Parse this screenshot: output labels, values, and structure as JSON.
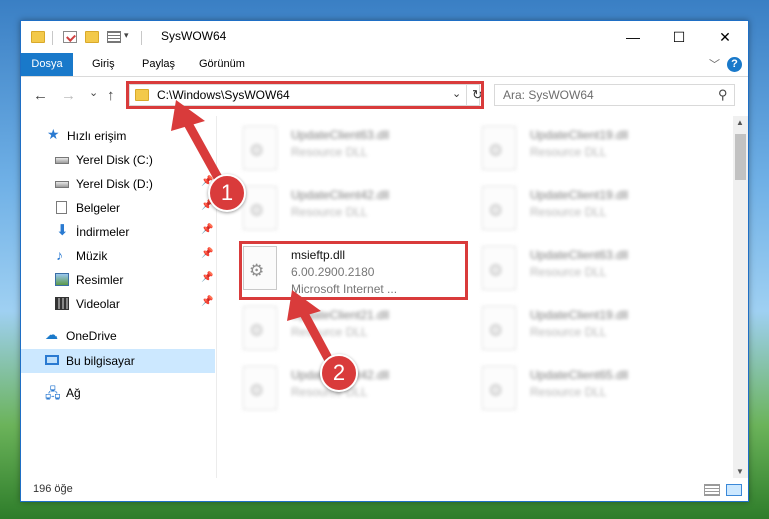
{
  "window": {
    "title": "SysWOW64",
    "minimize_glyph": "—",
    "maximize_glyph": "☐",
    "close_glyph": "✕",
    "accent": "#1979ca"
  },
  "ribbon": {
    "tabs": [
      "Dosya",
      "Giriş",
      "Paylaş",
      "Görünüm"
    ],
    "help_glyph": "?",
    "collapse_glyph": "﹀"
  },
  "nav": {
    "back_glyph": "←",
    "forward_glyph": "→",
    "recent_glyph": "⌄",
    "up_glyph": "↑",
    "address": "C:\\Windows\\SysWOW64",
    "address_chevron": "⌄",
    "refresh_glyph": "↻",
    "search_placeholder": "Ara: SysWOW64",
    "search_glyph": "⚲"
  },
  "sidebar": {
    "items": [
      {
        "label": "Hızlı erişim",
        "icon": "star-icon",
        "pinned": false
      },
      {
        "label": "Yerel Disk (C:)",
        "icon": "drive-icon",
        "pinned": true
      },
      {
        "label": "Yerel Disk (D:)",
        "icon": "drive-icon",
        "pinned": true
      },
      {
        "label": "Belgeler",
        "icon": "documents-icon",
        "pinned": true
      },
      {
        "label": "İndirmeler",
        "icon": "downloads-icon",
        "pinned": true
      },
      {
        "label": "Müzik",
        "icon": "music-icon",
        "pinned": true
      },
      {
        "label": "Resimler",
        "icon": "pictures-icon",
        "pinned": true
      },
      {
        "label": "Videolar",
        "icon": "videos-icon",
        "pinned": true
      },
      {
        "label": "OneDrive",
        "icon": "onedrive-icon",
        "pinned": false
      },
      {
        "label": "Bu bilgisayar",
        "icon": "this-pc-icon",
        "pinned": false,
        "selected": true
      },
      {
        "label": "Ağ",
        "icon": "network-icon",
        "pinned": false
      }
    ],
    "pin_glyph": "📌"
  },
  "files": {
    "left": [
      {
        "name": "UpdateClient63.dll",
        "type": "Resource DLL"
      },
      {
        "name": "UpdateClient42.dll",
        "type": "Resource DLL"
      },
      {
        "name": "msieftp.dll",
        "version": "6.00.2900.2180",
        "company": "Microsoft Internet ...",
        "highlighted": true
      },
      {
        "name": "UpdateClient21.dll",
        "type": "Resource DLL"
      },
      {
        "name": "UpdateClient42.dll",
        "type": "Resource DLL"
      }
    ],
    "right": [
      {
        "name": "UpdateClient19.dll",
        "type": "Resource DLL"
      },
      {
        "name": "UpdateClient19.dll",
        "type": "Resource DLL"
      },
      {
        "name": "UpdateClient63.dll",
        "type": "Resource DLL"
      },
      {
        "name": "UpdateClient19.dll",
        "type": "Resource DLL"
      },
      {
        "name": "UpdateClient65.dll",
        "type": "Resource DLL"
      }
    ]
  },
  "status": {
    "item_count": "196 öğe"
  },
  "annotations": {
    "badge1": "1",
    "badge2": "2",
    "color": "#d93b3b"
  }
}
